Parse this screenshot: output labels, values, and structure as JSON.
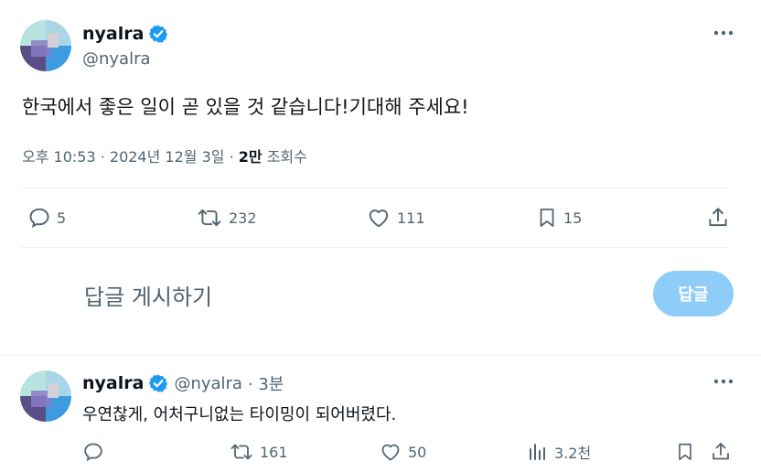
{
  "tweet": {
    "author_name": "nyalra",
    "author_handle": "@nyalra",
    "text": "한국에서 좋은 일이 곧 있을 것 같습니다!기대해 주세요!",
    "time": "오후 10:53 · 2024년 12월 3일",
    "views_count": "2만",
    "views_label": "조회수",
    "separator": " · ",
    "stats": {
      "replies": "5",
      "retweets": "232",
      "likes": "111",
      "bookmarks": "15"
    }
  },
  "composer": {
    "placeholder": "답글 게시하기",
    "button_label": "답글"
  },
  "reply": {
    "author_name": "nyalra",
    "author_handle": "@nyalra",
    "time": "· 3분",
    "text": "우연찮게, 어처구니없는 타이밍이 되어버렸다.",
    "stats": {
      "retweets": "161",
      "likes": "50",
      "views": "3.2천"
    }
  },
  "icons": {
    "verified": "verified-badge-icon",
    "more": "more-icon",
    "reply": "reply-icon",
    "retweet": "retweet-icon",
    "like": "heart-icon",
    "bookmark": "bookmark-icon",
    "share": "share-icon",
    "views": "views-icon"
  },
  "colors": {
    "accent": "#1d9bf0",
    "button_disabled": "#8ecdf8",
    "muted_text": "#536471"
  }
}
